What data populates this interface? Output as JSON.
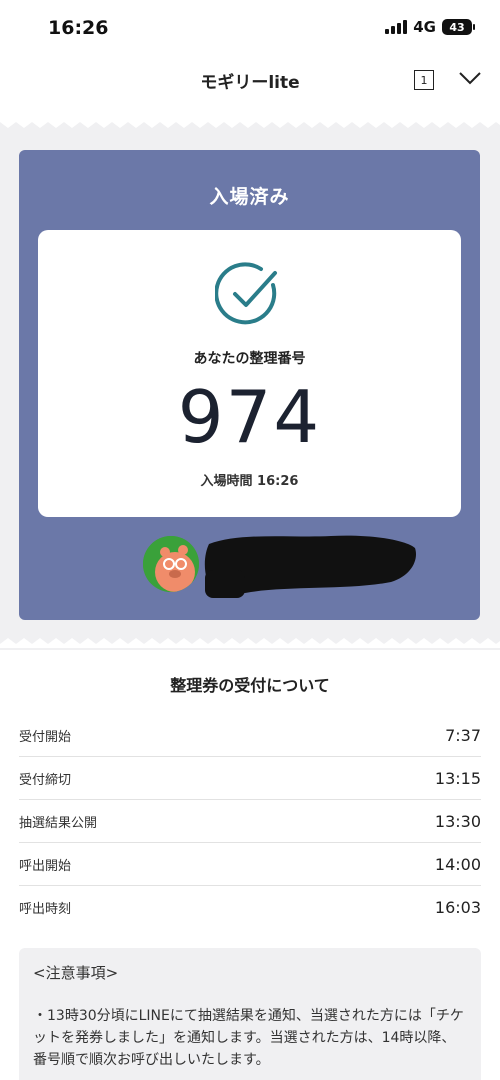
{
  "status_bar": {
    "time": "16:26",
    "network": "4G",
    "battery": "43"
  },
  "header": {
    "title": "モギリーlite",
    "tab_count": "1"
  },
  "ticket": {
    "status": "入場済み",
    "number_label": "あなたの整理番号",
    "number": "974",
    "entry_time": "入場時間 16:26"
  },
  "schedule": {
    "title": "整理券の受付について",
    "rows": [
      {
        "label": "受付開始",
        "value": "7:37"
      },
      {
        "label": "受付締切",
        "value": "13:15"
      },
      {
        "label": "抽選結果公開",
        "value": "13:30"
      },
      {
        "label": "呼出開始",
        "value": "14:00"
      },
      {
        "label": "呼出時刻",
        "value": "16:03"
      }
    ]
  },
  "notes": {
    "title": "<注意事項>",
    "body": "・13時30分頃にLINEにて抽選結果を通知、当選された方には「チケットを発券しました」を通知します。当選された方は、14時以降、番号順で順次お呼び出しいたします。"
  },
  "colors": {
    "ticket_bg": "#6b78a8",
    "check": "#2a7d8a",
    "page_bg": "#f0f0f2"
  }
}
